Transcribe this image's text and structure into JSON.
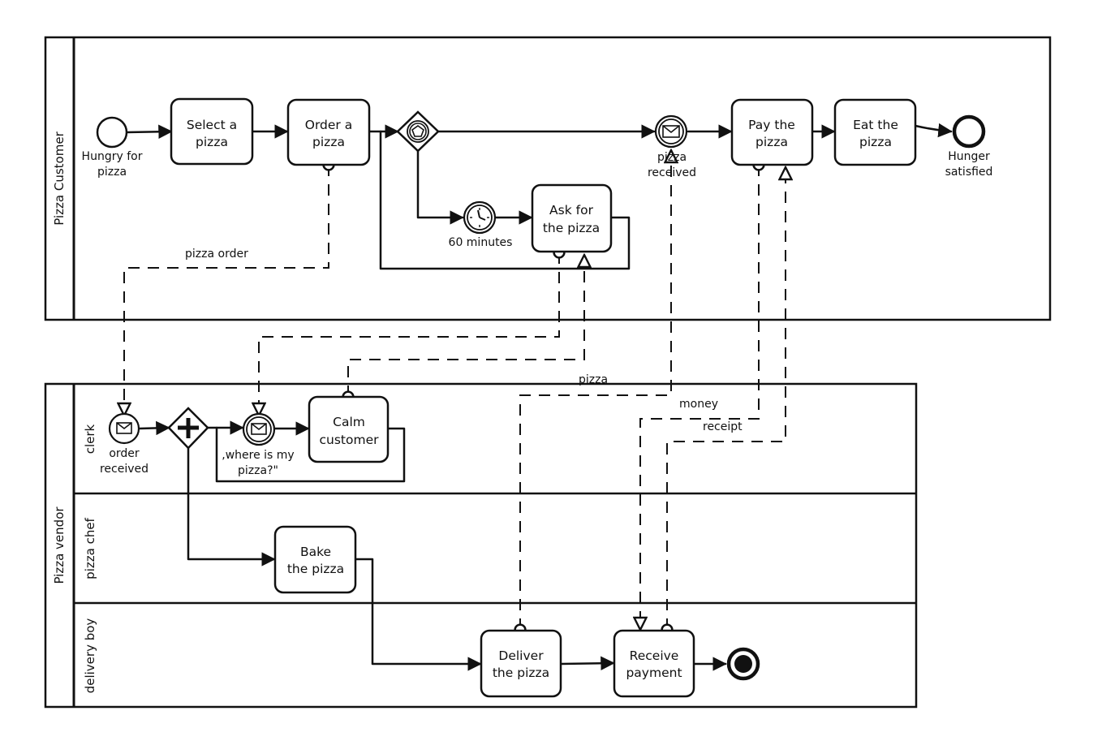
{
  "pools": {
    "customer": {
      "label": "Pizza Customer"
    },
    "vendor": {
      "label": "Pizza vendor",
      "lanes": [
        {
          "label": "clerk"
        },
        {
          "label": "pizza chef"
        },
        {
          "label": "delivery boy"
        }
      ]
    }
  },
  "events": {
    "start_customer": {
      "label_lines": [
        "Hungry for",
        "pizza"
      ],
      "type": "start"
    },
    "pizza_received": {
      "label_lines": [
        "pizza",
        "received"
      ],
      "type": "intermediate-message-catch"
    },
    "timer_60": {
      "label_lines": [
        "60 minutes"
      ],
      "type": "intermediate-timer"
    },
    "end_customer": {
      "label_lines": [
        "Hunger",
        "satisfied"
      ],
      "type": "end"
    },
    "order_received": {
      "label_lines": [
        "order",
        "received"
      ],
      "type": "start-message"
    },
    "where_is_pizza": {
      "label_lines": [
        ",where is my",
        "pizza?\""
      ],
      "type": "intermediate-message-catch"
    },
    "end_vendor": {
      "label_lines": [],
      "type": "end-terminate"
    }
  },
  "tasks": {
    "select_pizza": {
      "label_lines": [
        "Select a",
        "pizza"
      ]
    },
    "order_pizza": {
      "label_lines": [
        "Order a",
        "pizza"
      ]
    },
    "ask_pizza": {
      "label_lines": [
        "Ask for",
        "the pizza"
      ]
    },
    "pay_pizza": {
      "label_lines": [
        "Pay the",
        "pizza"
      ]
    },
    "eat_pizza": {
      "label_lines": [
        "Eat the",
        "pizza"
      ]
    },
    "calm_customer": {
      "label_lines": [
        "Calm",
        "customer"
      ]
    },
    "bake_pizza": {
      "label_lines": [
        "Bake",
        "the pizza"
      ]
    },
    "deliver_pizza": {
      "label_lines": [
        "Deliver",
        "the pizza"
      ]
    },
    "receive_payment": {
      "label_lines": [
        "Receive",
        "payment"
      ]
    }
  },
  "gateways": {
    "event_based": {
      "type": "event-based"
    },
    "parallel": {
      "type": "parallel"
    }
  },
  "message_flows": {
    "pizza_order": "pizza order",
    "pizza": "pizza",
    "money": "money",
    "receipt": "receipt"
  }
}
